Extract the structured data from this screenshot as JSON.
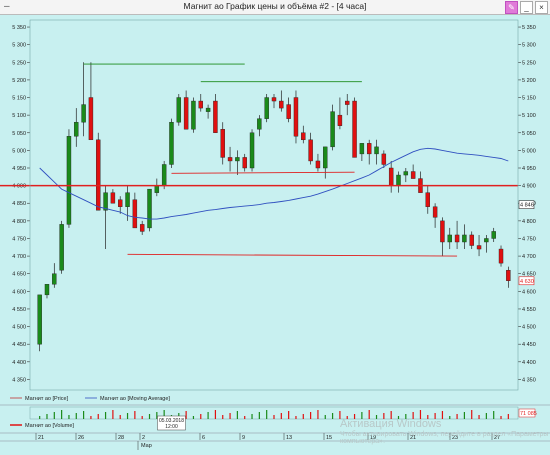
{
  "window": {
    "title": "Магнит ао График цены и объёма #2 - [4 часа]",
    "menu_icon": "dash-menu-icon",
    "buttons": [
      "pin",
      "minimize",
      "close"
    ]
  },
  "colors": {
    "background": "#c8f0f0",
    "bull": "#1a8a1a",
    "bear": "#e01010",
    "ma": "#3050c0",
    "hline_red": "#e02020",
    "trend_green": "#1a8a1a"
  },
  "legend": {
    "price": "Магнит ао [Price]",
    "ma": "Магнит ао [Moving Average]",
    "volume": "Магнит ао [Volume]"
  },
  "y_axis": {
    "ticks": [
      "5 350",
      "5 300",
      "5 250",
      "5 200",
      "5 150",
      "5 100",
      "5 050",
      "5 000",
      "4 950",
      "4 900",
      "4 850",
      "4 800",
      "4 750",
      "4 700",
      "4 650",
      "4 600",
      "4 550",
      "4 500",
      "4 450",
      "4 400",
      "4 350"
    ],
    "last_price_labels": [
      "4 846",
      "4 630"
    ]
  },
  "volume_label": "71 085",
  "x_axis": {
    "ticks": [
      "21",
      "26",
      "28",
      "2",
      "6",
      "9",
      "13",
      "15",
      "19",
      "21",
      "23",
      "27"
    ],
    "month_label": "Мар",
    "cursor_tooltip": "05.03.2018\n12:00"
  },
  "watermark": {
    "title": "Активация Windows",
    "subtitle": "Чтобы активировать Windows, перейдите в раздел «Параметры компьютера»."
  },
  "chart_data": {
    "type": "candlestick",
    "ylim": [
      4320,
      5370
    ],
    "candles": [
      {
        "o": 4450,
        "h": 4470,
        "l": 4430,
        "c": 4590
      },
      {
        "o": 4590,
        "h": 4620,
        "l": 4580,
        "c": 4620
      },
      {
        "o": 4620,
        "h": 4680,
        "l": 4610,
        "c": 4650
      },
      {
        "o": 4660,
        "h": 4800,
        "l": 4650,
        "c": 4790
      },
      {
        "o": 4790,
        "h": 5060,
        "l": 4780,
        "c": 5040
      },
      {
        "o": 5040,
        "h": 5120,
        "l": 5010,
        "c": 5080
      },
      {
        "o": 5080,
        "h": 5250,
        "l": 5040,
        "c": 5130
      },
      {
        "o": 5150,
        "h": 5250,
        "l": 5040,
        "c": 5030
      },
      {
        "o": 5030,
        "h": 5050,
        "l": 4830,
        "c": 4830
      },
      {
        "o": 4830,
        "h": 4900,
        "l": 4720,
        "c": 4880
      },
      {
        "o": 4880,
        "h": 4890,
        "l": 4850,
        "c": 4850
      },
      {
        "o": 4860,
        "h": 4870,
        "l": 4820,
        "c": 4840
      },
      {
        "o": 4840,
        "h": 4900,
        "l": 4800,
        "c": 4880
      },
      {
        "o": 4860,
        "h": 4880,
        "l": 4780,
        "c": 4780
      },
      {
        "o": 4790,
        "h": 4800,
        "l": 4760,
        "c": 4770
      },
      {
        "o": 4780,
        "h": 4890,
        "l": 4770,
        "c": 4890
      },
      {
        "o": 4880,
        "h": 4920,
        "l": 4870,
        "c": 4900
      },
      {
        "o": 4900,
        "h": 4970,
        "l": 4890,
        "c": 4960
      },
      {
        "o": 4960,
        "h": 5090,
        "l": 4950,
        "c": 5080
      },
      {
        "o": 5080,
        "h": 5160,
        "l": 5070,
        "c": 5150
      },
      {
        "o": 5150,
        "h": 5170,
        "l": 5060,
        "c": 5060
      },
      {
        "o": 5060,
        "h": 5150,
        "l": 5050,
        "c": 5140
      },
      {
        "o": 5140,
        "h": 5160,
        "l": 5110,
        "c": 5120
      },
      {
        "o": 5110,
        "h": 5130,
        "l": 5090,
        "c": 5120
      },
      {
        "o": 5140,
        "h": 5160,
        "l": 5050,
        "c": 5050
      },
      {
        "o": 5060,
        "h": 5080,
        "l": 4960,
        "c": 4980
      },
      {
        "o": 4980,
        "h": 5010,
        "l": 4940,
        "c": 4970
      },
      {
        "o": 4970,
        "h": 5000,
        "l": 4930,
        "c": 4980
      },
      {
        "o": 4980,
        "h": 4990,
        "l": 4940,
        "c": 4950
      },
      {
        "o": 4950,
        "h": 5060,
        "l": 4940,
        "c": 5050
      },
      {
        "o": 5060,
        "h": 5100,
        "l": 5040,
        "c": 5090
      },
      {
        "o": 5090,
        "h": 5160,
        "l": 5080,
        "c": 5150
      },
      {
        "o": 5150,
        "h": 5160,
        "l": 5120,
        "c": 5140
      },
      {
        "o": 5140,
        "h": 5170,
        "l": 5110,
        "c": 5120
      },
      {
        "o": 5130,
        "h": 5150,
        "l": 5080,
        "c": 5090
      },
      {
        "o": 5150,
        "h": 5170,
        "l": 5020,
        "c": 5040
      },
      {
        "o": 5050,
        "h": 5070,
        "l": 5020,
        "c": 5030
      },
      {
        "o": 5030,
        "h": 5050,
        "l": 4960,
        "c": 4970
      },
      {
        "o": 4970,
        "h": 4990,
        "l": 4940,
        "c": 4950
      },
      {
        "o": 4950,
        "h": 5010,
        "l": 4920,
        "c": 5010
      },
      {
        "o": 5010,
        "h": 5130,
        "l": 5000,
        "c": 5110
      },
      {
        "o": 5100,
        "h": 5150,
        "l": 5060,
        "c": 5070
      },
      {
        "o": 5140,
        "h": 5160,
        "l": 5100,
        "c": 5130
      },
      {
        "o": 5140,
        "h": 5150,
        "l": 4980,
        "c": 4980
      },
      {
        "o": 4990,
        "h": 5020,
        "l": 4970,
        "c": 5020
      },
      {
        "o": 5020,
        "h": 5030,
        "l": 4960,
        "c": 4990
      },
      {
        "o": 4990,
        "h": 5030,
        "l": 4960,
        "c": 5010
      },
      {
        "o": 4990,
        "h": 5000,
        "l": 4950,
        "c": 4960
      },
      {
        "o": 4950,
        "h": 4970,
        "l": 4880,
        "c": 4900
      },
      {
        "o": 4900,
        "h": 4940,
        "l": 4880,
        "c": 4930
      },
      {
        "o": 4930,
        "h": 4950,
        "l": 4910,
        "c": 4940
      },
      {
        "o": 4940,
        "h": 4960,
        "l": 4920,
        "c": 4920
      },
      {
        "o": 4920,
        "h": 4940,
        "l": 4890,
        "c": 4880
      },
      {
        "o": 4880,
        "h": 4900,
        "l": 4820,
        "c": 4840
      },
      {
        "o": 4840,
        "h": 4850,
        "l": 4780,
        "c": 4810
      },
      {
        "o": 4800,
        "h": 4810,
        "l": 4700,
        "c": 4740
      },
      {
        "o": 4740,
        "h": 4780,
        "l": 4720,
        "c": 4760
      },
      {
        "o": 4760,
        "h": 4800,
        "l": 4720,
        "c": 4740
      },
      {
        "o": 4740,
        "h": 4790,
        "l": 4720,
        "c": 4760
      },
      {
        "o": 4760,
        "h": 4770,
        "l": 4720,
        "c": 4730
      },
      {
        "o": 4730,
        "h": 4760,
        "l": 4700,
        "c": 4720
      },
      {
        "o": 4740,
        "h": 4760,
        "l": 4710,
        "c": 4750
      },
      {
        "o": 4750,
        "h": 4780,
        "l": 4740,
        "c": 4770
      },
      {
        "o": 4720,
        "h": 4730,
        "l": 4670,
        "c": 4680
      },
      {
        "o": 4660,
        "h": 4670,
        "l": 4610,
        "c": 4630
      }
    ],
    "moving_average": [
      4950,
      4930,
      4910,
      4890,
      4880,
      4870,
      4860,
      4850,
      4840,
      4835,
      4830,
      4825,
      4815,
      4810,
      4808,
      4805,
      4805,
      4808,
      4812,
      4815,
      4818,
      4822,
      4826,
      4830,
      4832,
      4835,
      4838,
      4840,
      4842,
      4844,
      4846,
      4850,
      4852,
      4855,
      4858,
      4862,
      4866,
      4870,
      4876,
      4883,
      4890,
      4898,
      4906,
      4914,
      4922,
      4930,
      4942,
      4954,
      4966,
      4976,
      4986,
      4996,
      5003,
      5006,
      5004,
      5000,
      4996,
      4992,
      4990,
      4988,
      4986,
      4983,
      4980,
      4977,
      4970
    ],
    "horizontal_level": 4900,
    "trendlines": [
      {
        "color": "green",
        "x0": 6,
        "x1": 28,
        "y0": 5245,
        "y1": 5245
      },
      {
        "color": "green",
        "x0": 22,
        "x1": 44,
        "y0": 5195,
        "y1": 5195
      },
      {
        "color": "red",
        "x0": 18,
        "x1": 43,
        "y0": 4935,
        "y1": 4938
      },
      {
        "color": "red",
        "x0": 12,
        "x1": 57,
        "y0": 4705,
        "y1": 4700
      }
    ]
  }
}
